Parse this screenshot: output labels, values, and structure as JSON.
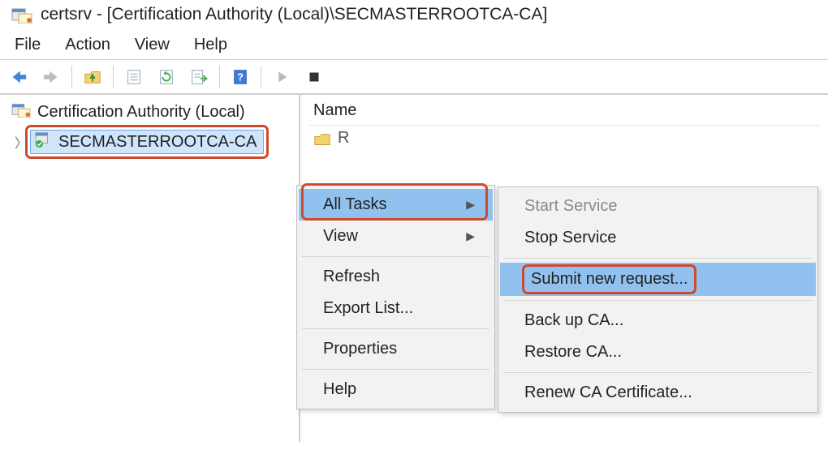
{
  "title": "certsrv - [Certification Authority (Local)\\SECMASTERROOTCA-CA]",
  "menubar": {
    "file": "File",
    "action": "Action",
    "view": "View",
    "help": "Help"
  },
  "tree": {
    "root_label": "Certification Authority (Local)",
    "child_label": "SECMASTERROOTCA-CA"
  },
  "right": {
    "column_header": "Name",
    "item0_partial": "R"
  },
  "context_menu1": {
    "all_tasks": "All Tasks",
    "view": "View",
    "refresh": "Refresh",
    "export_list": "Export List...",
    "properties": "Properties",
    "help": "Help"
  },
  "context_menu2": {
    "start_service": "Start Service",
    "stop_service": "Stop Service",
    "submit_new_request": "Submit new request...",
    "back_up_ca": "Back up CA...",
    "restore_ca": "Restore CA...",
    "renew_ca_cert": "Renew CA Certificate..."
  }
}
